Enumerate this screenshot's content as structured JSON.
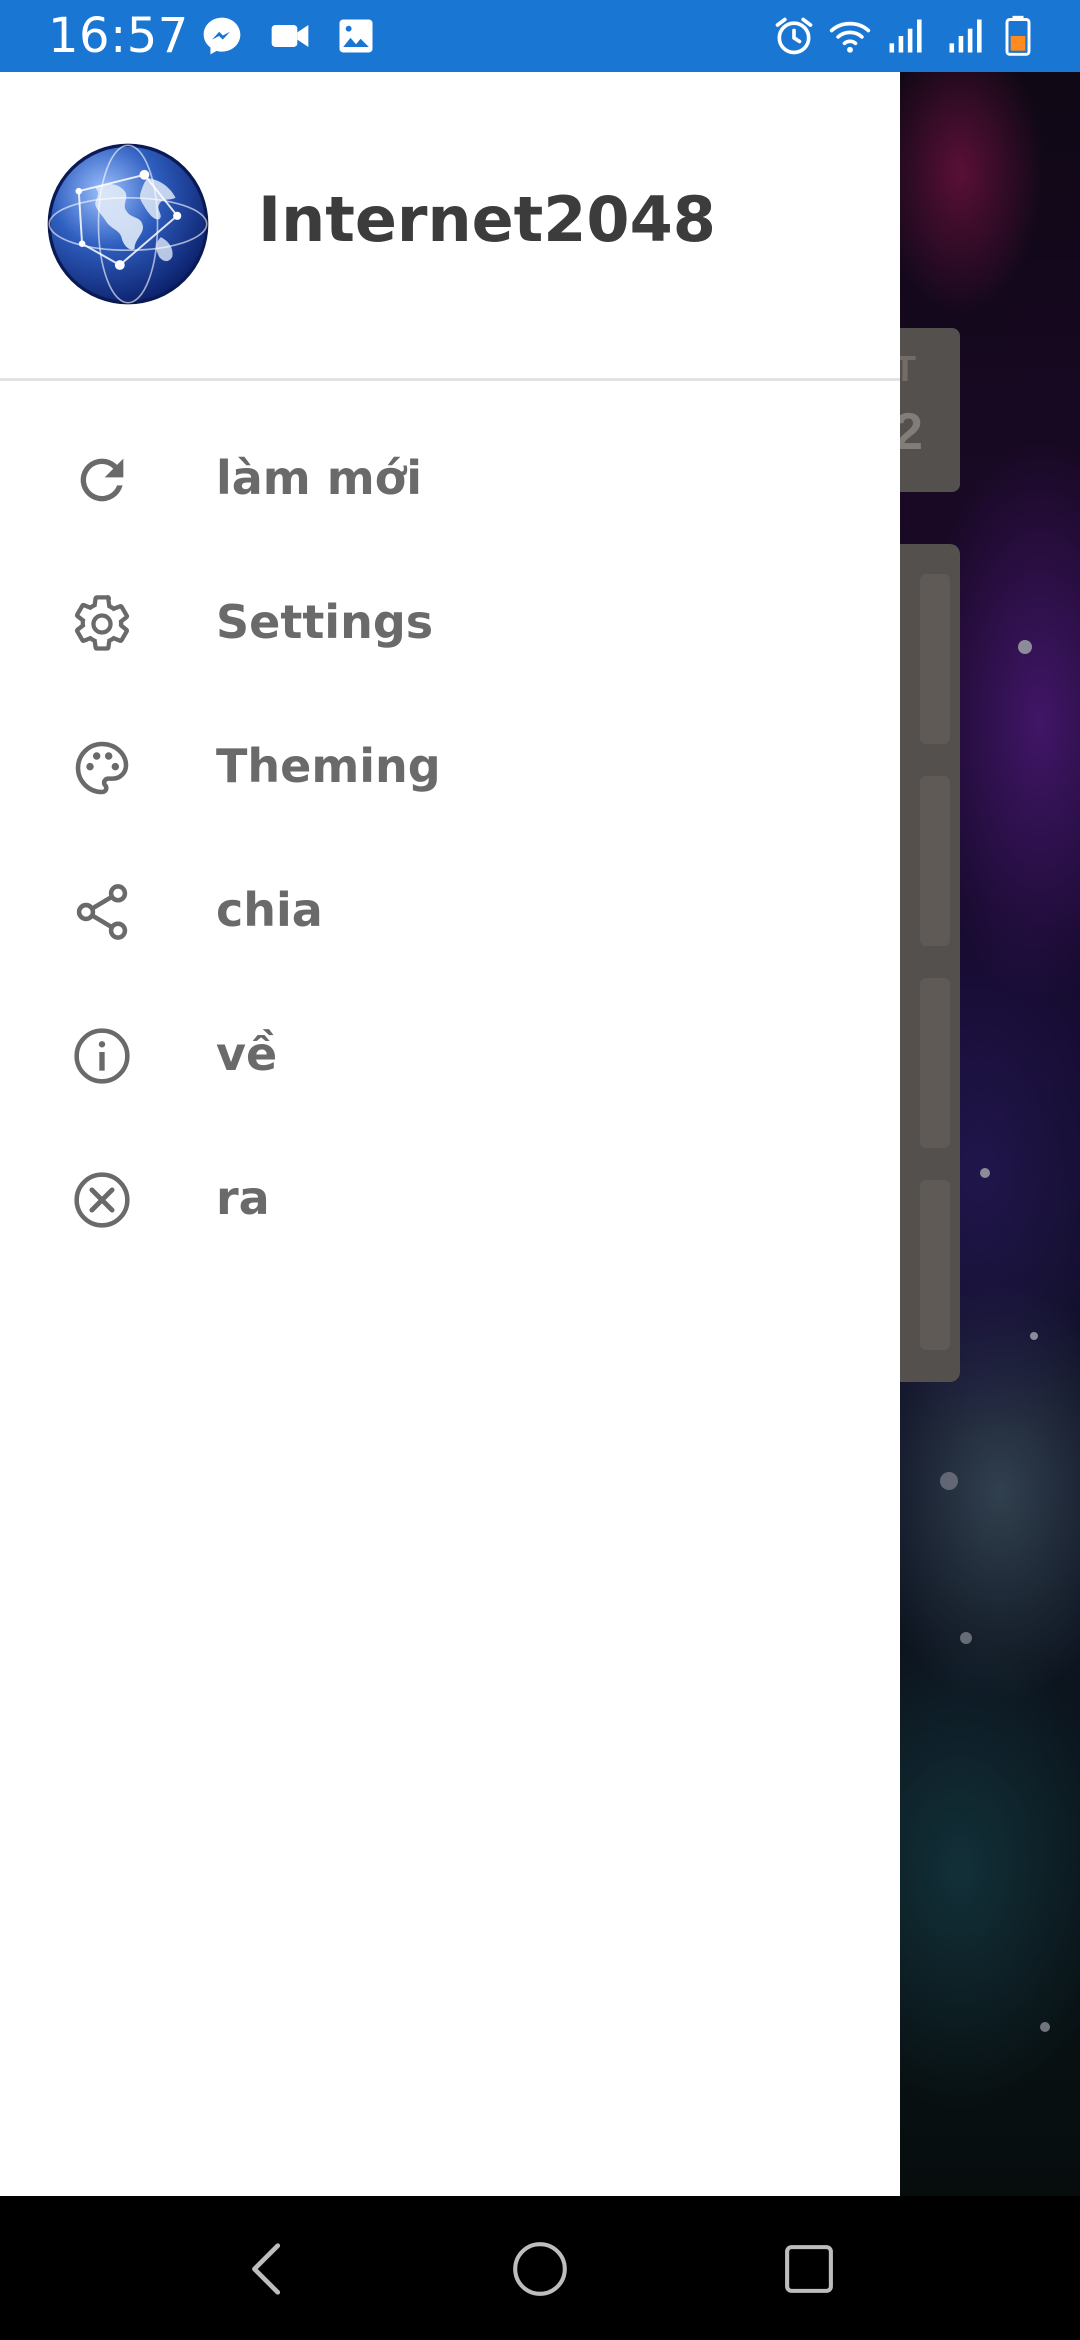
{
  "status_bar": {
    "time": "16:57",
    "left_icons": [
      "messenger-icon",
      "video-camera-icon",
      "image-icon"
    ],
    "right_icons": [
      "alarm-icon",
      "wifi-icon",
      "signal-icon",
      "signal-icon",
      "battery-icon"
    ],
    "color": "#1976d2"
  },
  "drawer": {
    "app_title": "Internet2048",
    "logo": "globe-logo",
    "items": [
      {
        "label": "làm mới",
        "icon": "refresh-icon"
      },
      {
        "label": "Settings",
        "icon": "gear-icon"
      },
      {
        "label": "Theming",
        "icon": "palette-icon"
      },
      {
        "label": "chia",
        "icon": "share-icon"
      },
      {
        "label": "về",
        "icon": "info-icon"
      },
      {
        "label": "ra",
        "icon": "close-circle-icon"
      }
    ],
    "label_color": "#6a6a6a"
  },
  "background_app": {
    "score_label_partial": "T",
    "score_value_partial": "2"
  },
  "nav_bar": {
    "buttons": [
      "back-icon",
      "home-icon",
      "recents-icon"
    ]
  }
}
